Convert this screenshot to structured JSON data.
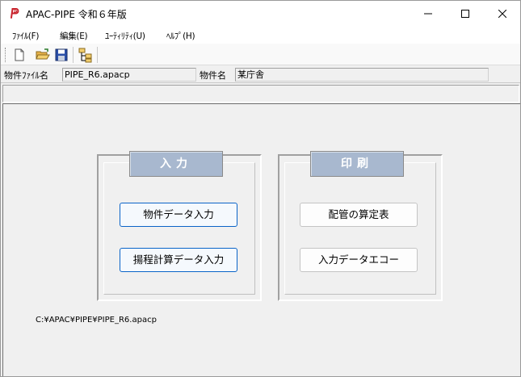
{
  "window": {
    "title": "APAC-PIPE 令和６年版"
  },
  "menu": [
    {
      "label": "ﾌｧｲﾙ(F)"
    },
    {
      "label": "編集(E)"
    },
    {
      "label": "ﾕｰﾃｨﾘﾃｨ(U)"
    },
    {
      "label": "ﾍﾙﾌﾟ(H)"
    }
  ],
  "toolbar": {
    "icons": [
      "new-file-icon",
      "open-folder-icon",
      "save-icon",
      "tree-icon"
    ]
  },
  "info": {
    "file_label": "物件ﾌｧｲﾙ名",
    "file_value": "PIPE_R6.apacp",
    "name_label": "物件名",
    "name_value": "某庁舎"
  },
  "input_group": {
    "title": "入力",
    "buttons": [
      "物件データ入力",
      "揚程計算データ入力"
    ]
  },
  "print_group": {
    "title": "印刷",
    "buttons": [
      "配管の算定表",
      "入力データエコー"
    ]
  },
  "path": "C:¥APAC¥PIPE¥PIPE_R6.apacp",
  "colors": {
    "group_tab": "#a8b8cf",
    "focus_border": "#0a64c8"
  }
}
